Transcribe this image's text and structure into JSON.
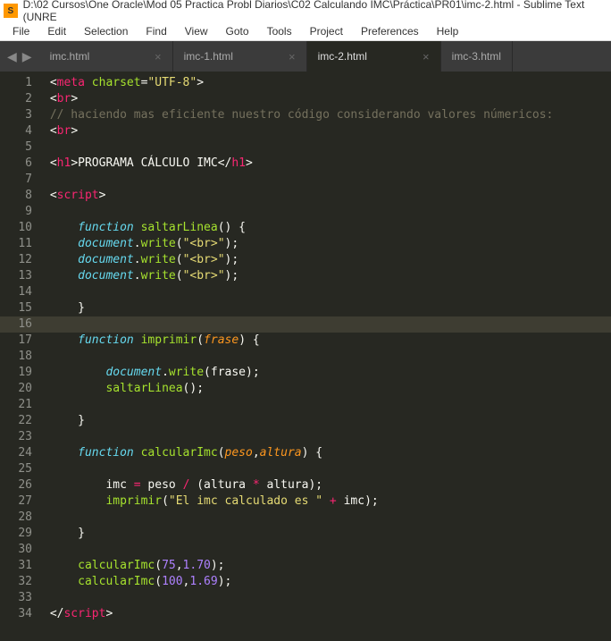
{
  "titlebar": "D:\\02 Cursos\\One Oracle\\Mod 05 Practica Probl Diarios\\C02 Calculando IMC\\Práctica\\PR01\\imc-2.html - Sublime Text (UNRE",
  "menu": {
    "file": "File",
    "edit": "Edit",
    "selection": "Selection",
    "find": "Find",
    "view": "View",
    "goto": "Goto",
    "tools": "Tools",
    "project": "Project",
    "preferences": "Preferences",
    "help": "Help"
  },
  "nav": {
    "back": "◀",
    "forward": "▶"
  },
  "tabs": {
    "t1": "imc.html",
    "t2": "imc-1.html",
    "t3": "imc-2.html",
    "t4": "imc-3.html",
    "close": "×"
  },
  "lines": {
    "l1": "1",
    "l2": "2",
    "l3": "3",
    "l4": "4",
    "l5": "5",
    "l6": "6",
    "l7": "7",
    "l8": "8",
    "l9": "9",
    "l10": "10",
    "l11": "11",
    "l12": "12",
    "l13": "13",
    "l14": "14",
    "l15": "15",
    "l16": "16",
    "l17": "17",
    "l18": "18",
    "l19": "19",
    "l20": "20",
    "l21": "21",
    "l22": "22",
    "l23": "23",
    "l24": "24",
    "l25": "25",
    "l26": "26",
    "l27": "27",
    "l28": "28",
    "l29": "29",
    "l30": "30",
    "l31": "31",
    "l32": "32",
    "l33": "33",
    "l34": "34"
  },
  "code": {
    "meta_charset_attr": "charset",
    "meta_charset_val": "\"UTF-8\"",
    "tag_meta": "meta",
    "tag_br": "br",
    "tag_h1": "h1",
    "tag_script": "script",
    "comment_line": "// haciendo mas eficiente nuestro código considerando valores númericos:",
    "h1_text": "PROGRAMA CÁLCULO IMC",
    "kw_function": "function",
    "fn_saltarLinea": "saltarLinea",
    "fn_imprimir": "imprimir",
    "fn_calcularImc": "calcularImc",
    "obj_document": "document",
    "m_write": "write",
    "str_br": "\"<br>\"",
    "param_frase": "frase",
    "param_peso": "peso",
    "param_altura": "altura",
    "var_imc": "imc",
    "var_peso": "peso",
    "var_altura": "altura",
    "str_imc_msg": "\"El imc calculado es \"",
    "num_75": "75",
    "num_170": "1.70",
    "num_100": "100",
    "num_169": "1.69"
  }
}
